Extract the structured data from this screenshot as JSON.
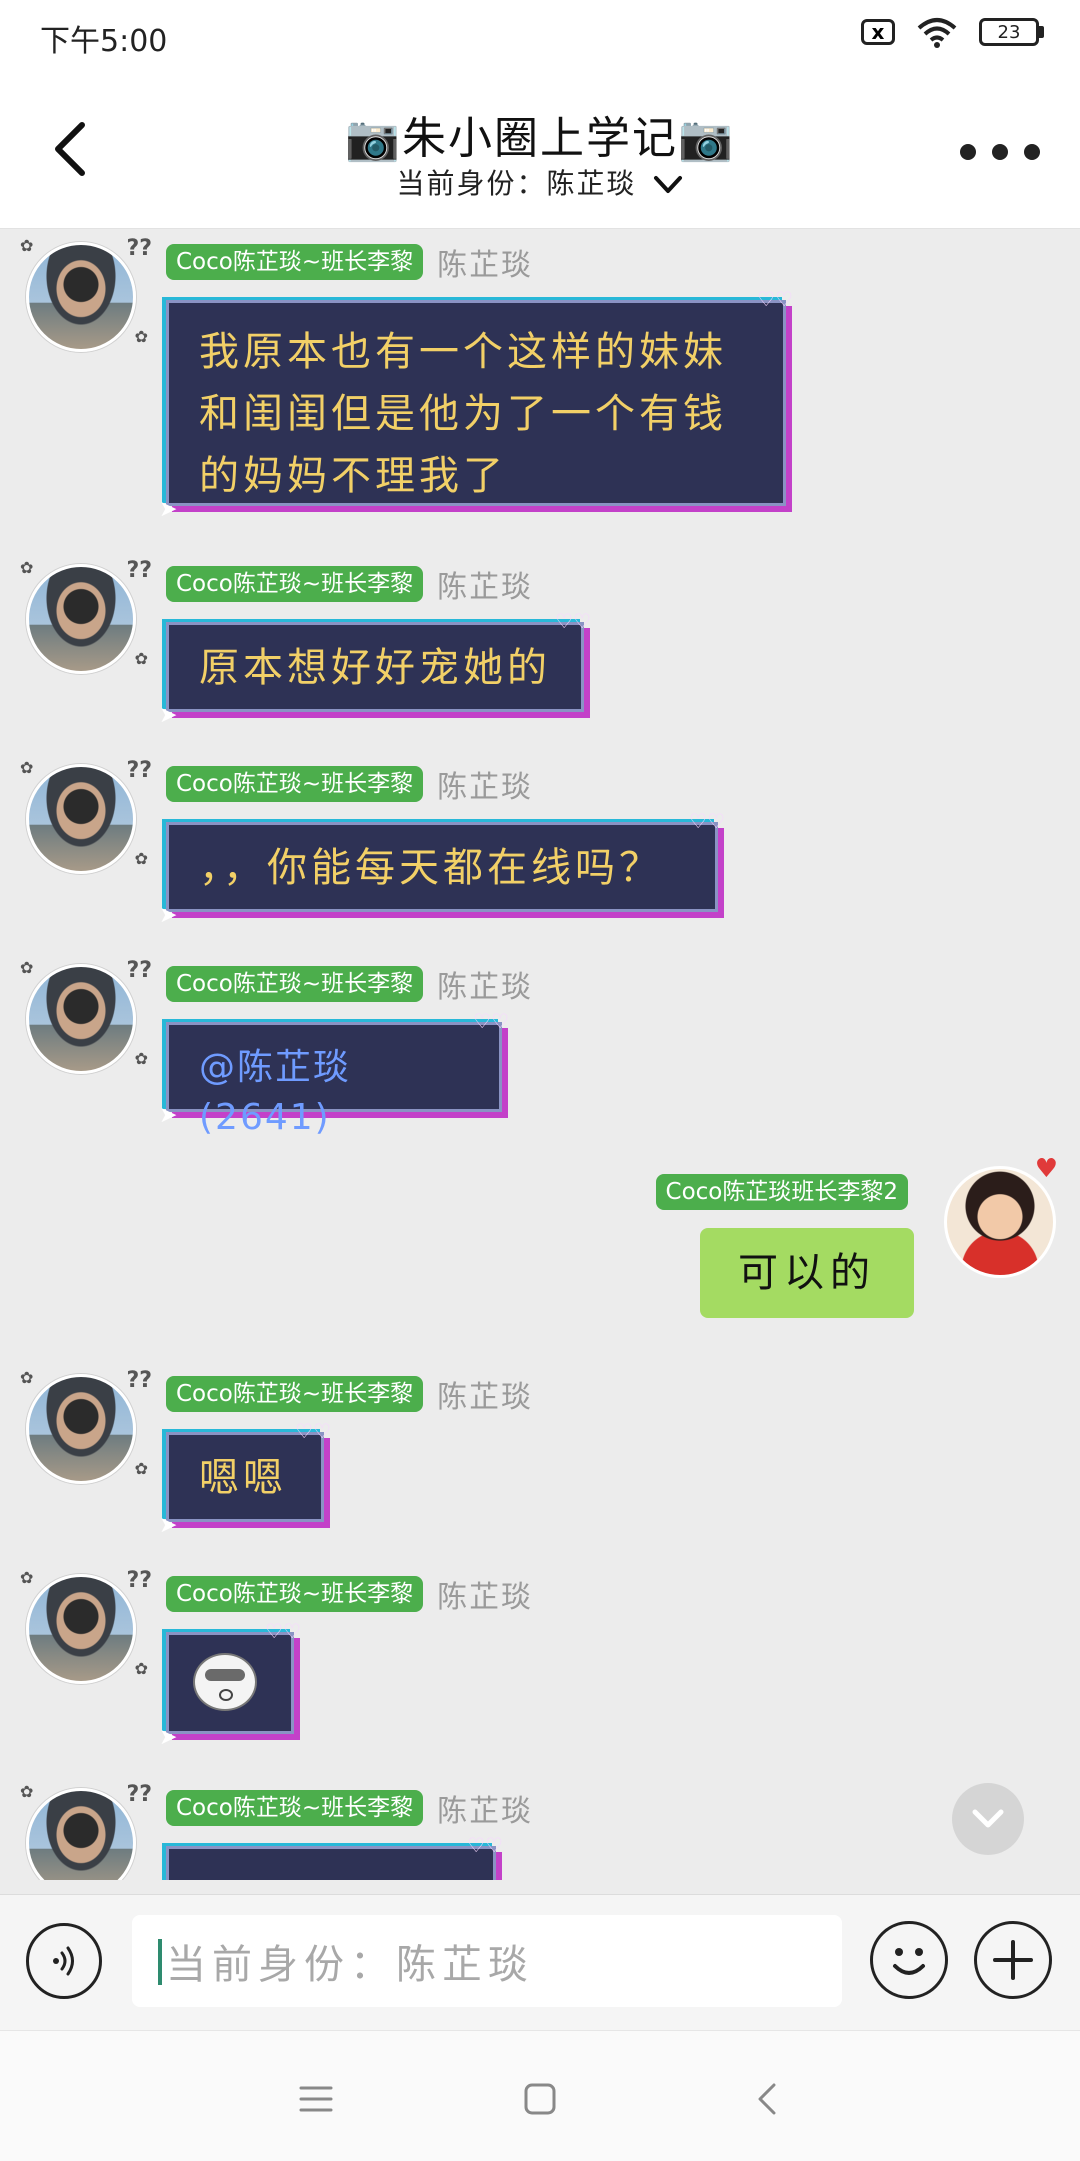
{
  "status_bar": {
    "time": "下午5:00",
    "sim_icon": "x",
    "battery_level": "23"
  },
  "header": {
    "title": "📷朱小圈上学记📷",
    "identity_label": "当前身份：",
    "identity_value": "陈芷琰"
  },
  "messages": [
    {
      "sender_tag": "Coco陈芷琰~班长李黎",
      "sender_name": "陈芷琰",
      "text": "我原本也有一个这样的妹妹和闺闺但是他为了一个有钱的妈妈不理我了"
    },
    {
      "sender_tag": "Coco陈芷琰~班长李黎",
      "sender_name": "陈芷琰",
      "text": "原本想好好宠她的"
    },
    {
      "sender_tag": "Coco陈芷琰~班长李黎",
      "sender_name": "陈芷琰",
      "text": "，，你能每天都在线吗？"
    },
    {
      "sender_tag": "Coco陈芷琰~班长李黎",
      "sender_name": "陈芷琰",
      "text": "@陈芷琰(2641)"
    },
    {
      "sender_tag": "Coco陈芷琰班长李黎2",
      "text": "可以的"
    },
    {
      "sender_tag": "Coco陈芷琰~班长李黎",
      "sender_name": "陈芷琰",
      "text": "嗯嗯"
    },
    {
      "sender_tag": "Coco陈芷琰~班长李黎",
      "sender_name": "陈芷琰",
      "sticker": "sticker-face"
    },
    {
      "sender_tag": "Coco陈芷琰~班长李黎",
      "sender_name": "陈芷琰"
    }
  ],
  "input": {
    "placeholder": "当前身份：陈芷琰"
  },
  "icons": {
    "back": "chevron-left-icon",
    "more": "more-dots-icon",
    "scroll_down": "chevron-down-icon",
    "voice": "voice-icon",
    "emoji": "emoji-icon",
    "plus": "plus-icon"
  },
  "colors": {
    "group_tag": "#4cae4c",
    "bubble_bg": "#2e3255",
    "bubble_text": "#f2d067",
    "mention_text": "#6f9bff",
    "self_bubble": "#a4db62"
  }
}
